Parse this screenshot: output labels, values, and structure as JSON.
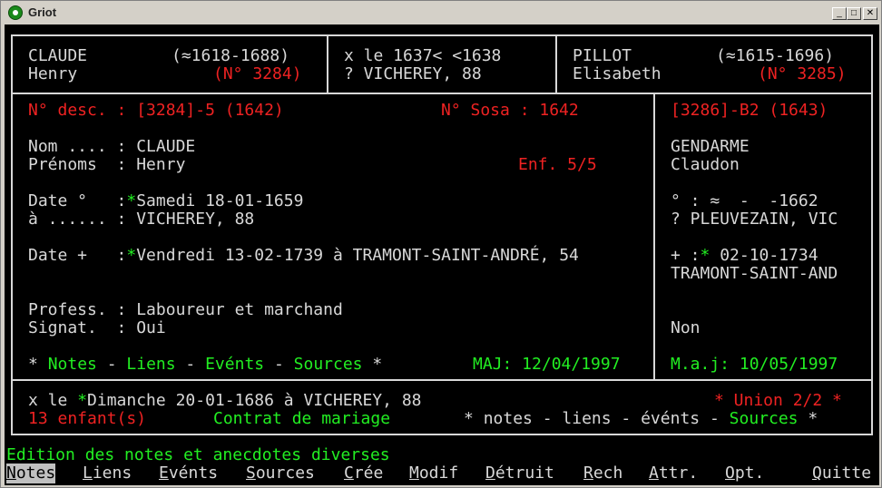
{
  "window": {
    "title": "Griot",
    "minimize": "_",
    "maximize": "□",
    "close": "✕"
  },
  "father": {
    "surname": "CLAUDE",
    "dates": "(≈1618-1688)",
    "firstname": "Henry",
    "num": "(N° 3284)"
  },
  "marriage": {
    "line1": "x le 1637< <1638",
    "line2": "? VICHEREY, 88"
  },
  "mother": {
    "surname": "PILLOT",
    "dates": "(≈1615-1696)",
    "firstname": "Elisabeth",
    "num": "(N° 3285)"
  },
  "person": {
    "desc": "N° desc. : [3284]-5 (1642)",
    "sosa": "N° Sosa : 1642",
    "nom_label": "Nom .... : ",
    "nom_value": "CLAUDE",
    "prenoms_label": "Prénoms  : ",
    "prenoms_value": "Henry",
    "enf": "Enf. 5/5",
    "birth_label": "Date °   :",
    "birth_star": "*",
    "birth_value": "Samedi 18-01-1659",
    "place_label": "à ...... : ",
    "place_value": "VICHEREY, 88",
    "death_label": "Date +   :",
    "death_star": "*",
    "death_value": "Vendredi 13-02-1739 à TRAMONT-SAINT-ANDRÉ, 54",
    "prof_label": "Profess. : ",
    "prof_value": "Laboureur et marchand",
    "signat_label": "Signat.  : ",
    "signat_value": "Oui",
    "star1": "* ",
    "notes": "Notes",
    "sep1": " - ",
    "liens": "Liens",
    "sep2": " - ",
    "events": "Evénts",
    "sep3": " - ",
    "sources": "Sources",
    "star2": " *",
    "maj": "MAJ: 12/04/1997"
  },
  "spouse": {
    "ref": "[3286]-B2 (1643)",
    "surname": "GENDARME",
    "firstname": "Claudon",
    "birth": "° : ≈  -  -1662",
    "birth_place": "? PLEUVEZAIN, VIC",
    "death_prefix": "+ :",
    "death_star": "*",
    "death_date": " 02-10-1734",
    "death_place": "TRAMONT-SAINT-AND",
    "signat": "Non",
    "maj": "M.a.j: 10/05/1997"
  },
  "union": {
    "line1_prefix": "x le ",
    "line1_star": "*",
    "line1_value": "Dimanche 20-01-1686 à VICHEREY, 88",
    "union_label": "* Union 2/2 *",
    "children": "13 enfant(s)",
    "contract": "Contrat de mariage",
    "links_star1": "* ",
    "links_notes": "notes",
    "links_sep1": " - ",
    "links_liens": "liens",
    "links_sep2": " - ",
    "links_events": "événts",
    "links_sep3": " - ",
    "links_sources": "Sources",
    "links_star2": " *"
  },
  "status_line": "Edition des notes et anecdotes diverses",
  "menu": [
    {
      "key": "N",
      "rest": "otes"
    },
    {
      "key": "L",
      "rest": "iens"
    },
    {
      "key": "E",
      "rest": "vénts"
    },
    {
      "key": "S",
      "rest": "ources"
    },
    {
      "key": "C",
      "rest": "rée"
    },
    {
      "key": "M",
      "rest": "odif"
    },
    {
      "key": "D",
      "rest": "étruit"
    },
    {
      "key": "R",
      "rest": "ech"
    },
    {
      "key": "A",
      "rest": "ttr."
    },
    {
      "key": "O",
      "rest": "pt."
    },
    {
      "key": "Q",
      "rest": "uitte"
    }
  ],
  "colors": {
    "background": "#000000",
    "text": "#d8d8d8",
    "red": "#ee2222",
    "green": "#22ee22",
    "menu_highlight": "#c0c0c0"
  }
}
